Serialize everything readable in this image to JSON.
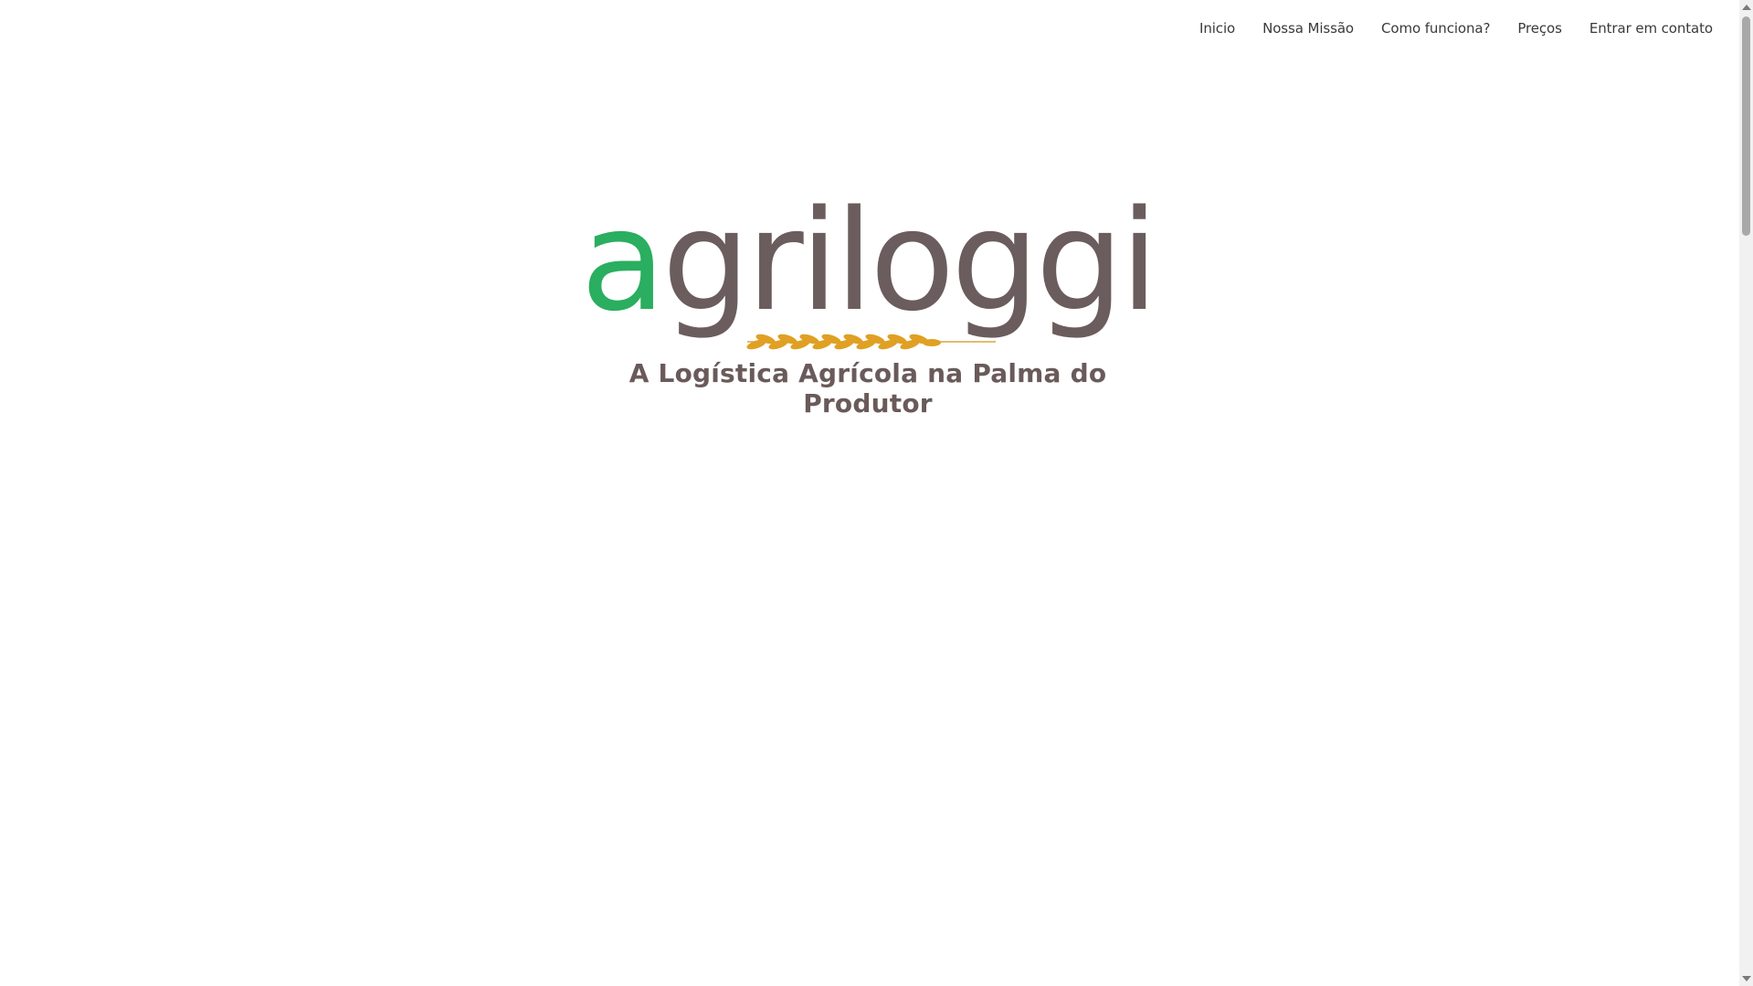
{
  "nav": {
    "items": [
      {
        "label": "Inicio"
      },
      {
        "label": "Nossa Missão"
      },
      {
        "label": "Como funciona?"
      },
      {
        "label": "Preços"
      },
      {
        "label": "Entrar em contato"
      }
    ]
  },
  "hero": {
    "logo_word": "agriloggi",
    "logo_first_letter": "a",
    "logo_rest": "griloggi",
    "tagline": "A Logística Agrícola na Palma do Produtor",
    "wheat_icon": "wheat-ear-icon"
  },
  "colors": {
    "brand_green": "#2aae5f",
    "brand_brown": "#6b5d5d",
    "wheat_gold": "#e0a023",
    "nav_text": "#3a3a3a"
  }
}
